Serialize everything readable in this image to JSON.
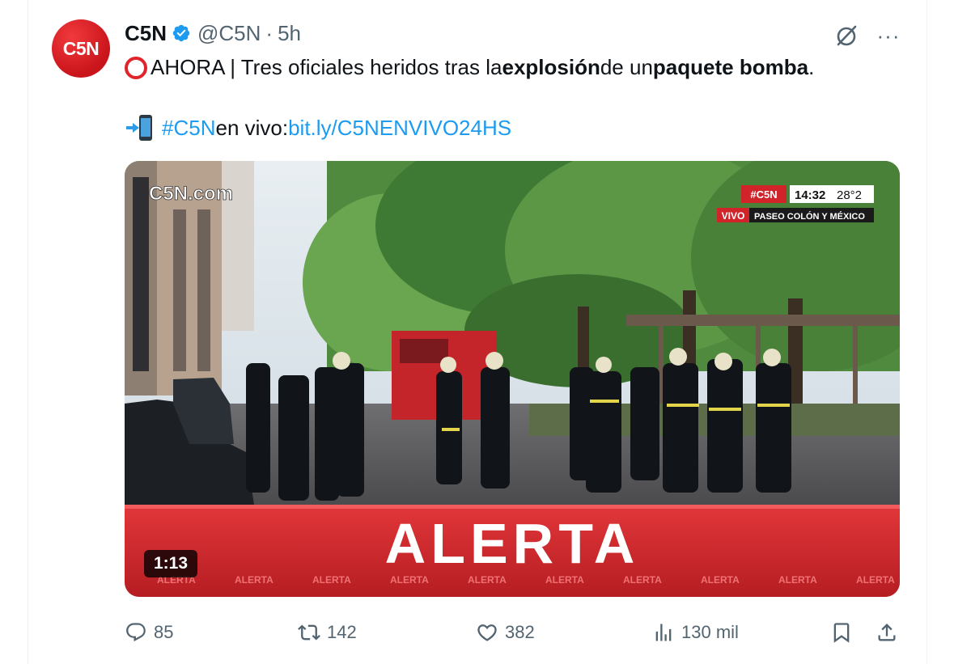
{
  "tweet": {
    "avatar_text": "C5N",
    "name": "C5N",
    "handle": "@C5N",
    "separator": "·",
    "time": "5h",
    "more_label": "···",
    "text_prefix": "AHORA | Tres oficiales heridos tras la ",
    "text_bold1": "explosión",
    "text_mid": " de un ",
    "text_bold2": "paquete bomba",
    "text_end": ".",
    "hashtag": "#C5N",
    "live_text": " en vivo: ",
    "link": "bit.ly/C5NENVIVO24HS"
  },
  "video": {
    "watermark": "C5N.com",
    "bug_brand": "#C5N",
    "bug_time": "14:32",
    "bug_temp": "28°2",
    "vivo_label": "VIVO",
    "location": "PASEO COLÓN Y MÉXICO",
    "banner": "ALERTA",
    "ticker_word": "ALERTA",
    "duration": "1:13"
  },
  "actions": {
    "replies": "85",
    "retweets": "142",
    "likes": "382",
    "views": "130 mil"
  },
  "colors": {
    "accent": "#1d9bf0",
    "brand_red": "#e0242b",
    "muted": "#536471"
  },
  "icons": [
    "verified-badge-icon",
    "grok-icon",
    "more-icon",
    "reply-icon",
    "retweet-icon",
    "like-icon",
    "views-icon",
    "bookmark-icon",
    "share-icon"
  ]
}
